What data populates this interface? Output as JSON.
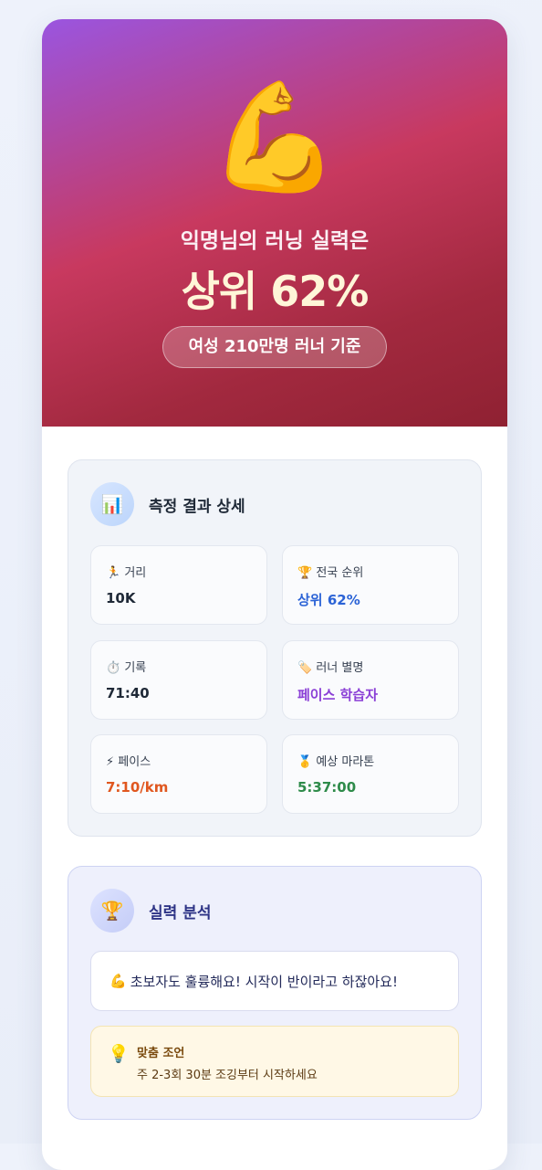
{
  "hero": {
    "emoji": "💪",
    "subtitle": "익명님의 러닝 실력은",
    "rank": "상위 62%",
    "basis": "여성 210만명 러너 기준"
  },
  "details": {
    "icon": "📊",
    "title": "측정 결과 상세",
    "stats": [
      {
        "icon": "🏃",
        "label": "거리",
        "value": "10K"
      },
      {
        "icon": "🏆",
        "label": "전국 순위",
        "value": "상위 62%"
      },
      {
        "icon": "⏱️",
        "label": "기록",
        "value": "71:40"
      },
      {
        "icon": "🏷️",
        "label": "러너 별명",
        "value": "페이스 학습자"
      },
      {
        "icon": "⚡",
        "label": "페이스",
        "value": "7:10/km"
      },
      {
        "icon": "🥇",
        "label": "예상 마라톤",
        "value": "5:37:00"
      }
    ]
  },
  "analysis": {
    "icon": "🏆",
    "title": "실력 분석",
    "message_emoji": "💪",
    "message": "초보자도 훌륭해요! 시작이 반이라고 하잖아요!",
    "advice_icon": "💡",
    "advice_title": "맞춤 조언",
    "advice_text": "주 2-3회 30분 조깅부터 시작하세요"
  },
  "colors": {
    "rank_blue": "#2b63d6",
    "nickname_purple": "#8a3fd6",
    "pace_orange": "#e0571f",
    "marathon_green": "#2e8b4a"
  }
}
